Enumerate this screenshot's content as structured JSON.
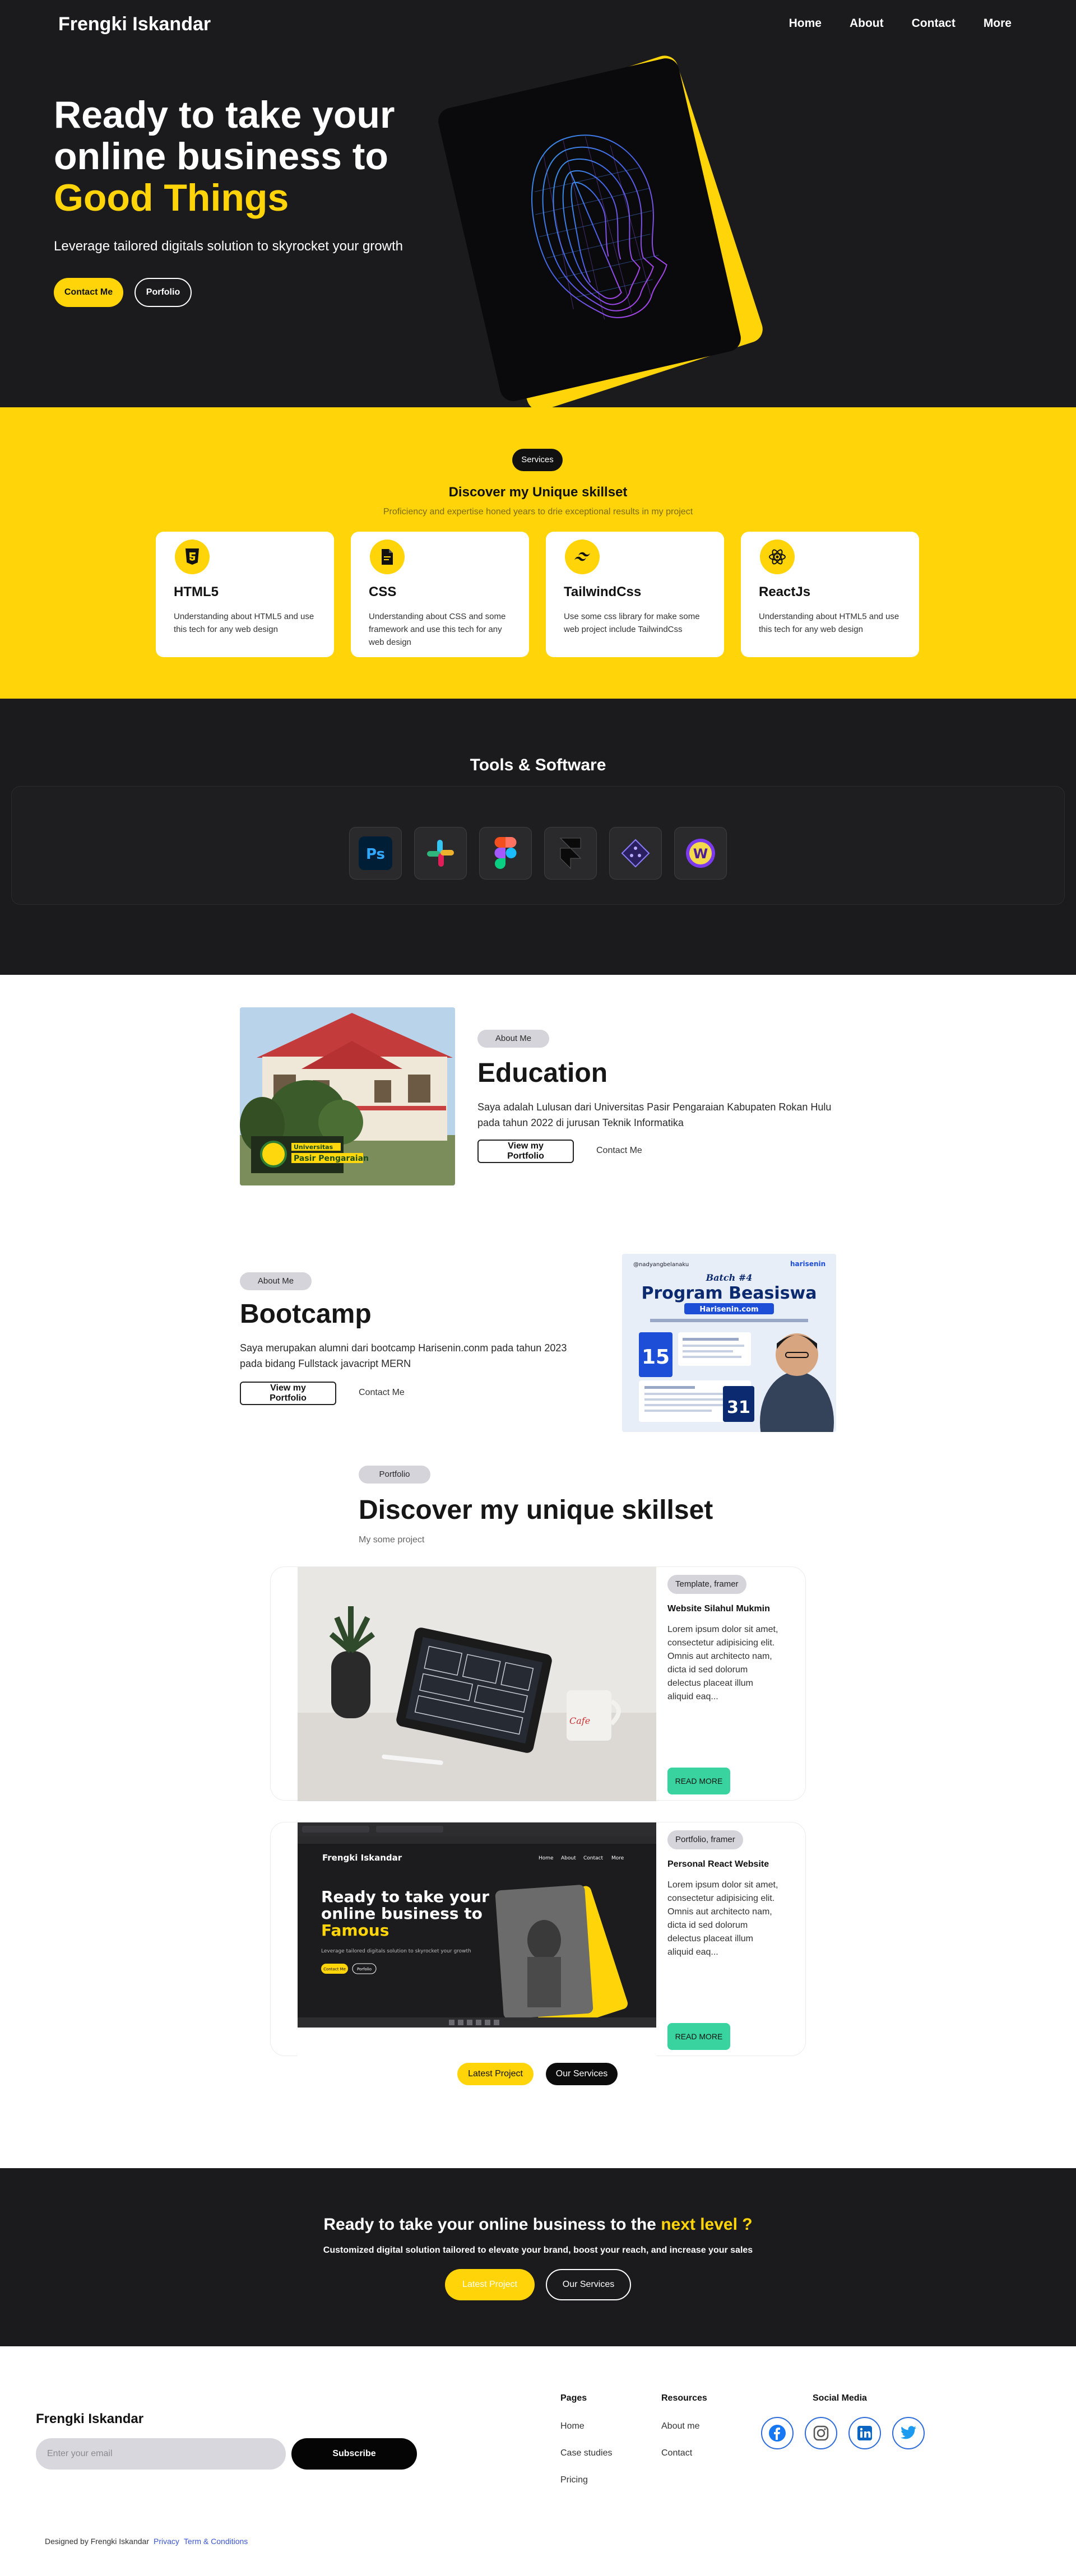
{
  "nav": {
    "brand": "Frengki Iskandar",
    "links": [
      "Home",
      "About",
      "Contact",
      "More"
    ]
  },
  "hero": {
    "title_line1": "Ready to take your",
    "title_line2": "online business to",
    "title_highlight": "Good Things",
    "subtitle": "Leverage tailored digitals solution to skyrocket your growth",
    "cta_primary": "Contact Me",
    "cta_secondary": "Porfolio"
  },
  "services": {
    "badge": "Services",
    "title": "Discover my Unique skillset",
    "subtitle": "Proficiency and expertise honed years to drie exceptional results in my project",
    "items": [
      {
        "name": "HTML5",
        "icon": "html5-icon",
        "desc": "Understanding about HTML5 and use this tech for any web design"
      },
      {
        "name": "CSS",
        "icon": "css-file-icon",
        "desc": "Understanding about CSS and some framework and use this tech for any web design"
      },
      {
        "name": "TailwindCss",
        "icon": "tailwind-icon",
        "desc": "Use some css library for make some web project include TailwindCss"
      },
      {
        "name": "ReactJs",
        "icon": "react-icon",
        "desc": "Understanding about HTML5 and use this tech for any web design"
      }
    ]
  },
  "tools": {
    "title": "Tools & Software",
    "items": [
      "photoshop-icon",
      "slack-icon",
      "figma-icon",
      "framer-icon",
      "linear-icon",
      "webflow-icon"
    ]
  },
  "about": {
    "education": {
      "badge": "About Me",
      "title": "Education",
      "text": "Saya adalah Lulusan dari Universitas Pasir Pengaraian Kabupaten Rokan Hulu pada tahun 2022 di jurusan Teknik Informatika",
      "btn": "View my Portfolio",
      "link": "Contact Me",
      "image_sign_line1": "Universitas",
      "image_sign_line2": "Pasir Pengaraian"
    },
    "bootcamp": {
      "badge": "About Me",
      "title": "Bootcamp",
      "text": "Saya merupakan alumni dari bootcamp Harisenin.conm pada tahun 2023 pada bidang Fullstack javacript MERN",
      "btn": "View my Portfolio",
      "link": "Contact Me",
      "poster": {
        "handle": "@nadyangbelanaku",
        "brand": "harisenin",
        "batch": "Batch #4",
        "title": "Program Beasiswa",
        "site": "Harisenin.com",
        "date1": "15",
        "date2": "31"
      }
    }
  },
  "portfolio": {
    "badge": "Portfolio",
    "title": "Discover my unique skillset",
    "subtitle": "My some project",
    "projects": [
      {
        "tag": "Template, framer",
        "name": "Website Silahul Mukmin",
        "desc": "Lorem ipsum dolor sit amet, consectetur adipisicing elit. Omnis aut architecto nam, dicta id sed dolorum delectus placeat illum aliquid eaq...",
        "btn": "READ MORE"
      },
      {
        "tag": "Portfolio, framer",
        "name": "Personal React Website",
        "desc": "Lorem ipsum dolor sit amet, consectetur adipisicing elit. Omnis aut architecto nam, dicta id sed dolorum delectus placeat illum aliquid eaq...",
        "btn": "READ MORE"
      }
    ],
    "btn_latest": "Latest Project",
    "btn_services": "Our Services",
    "mock": {
      "brand": "Frengki Iskandar",
      "nav": [
        "Home",
        "About",
        "Contact",
        "More"
      ],
      "line1": "Ready to take your",
      "line2": "online business to",
      "highlight": "Famous",
      "sub": "Leverage tailored digitals solution to skyrocket your growth",
      "btn1": "Contact Me",
      "btn2": "Porfolio"
    }
  },
  "cta": {
    "title_main": "Ready to take your online business to the ",
    "title_highlight": "next level ?",
    "subtitle": "Customized digital solution tailored to elevate your brand, boost your reach, and increase your sales",
    "btn_primary": "Latest Project",
    "btn_secondary": "Our Services"
  },
  "footer": {
    "brand": "Frengki Iskandar",
    "email_placeholder": "Enter your email",
    "subscribe": "Subscribe",
    "pages_title": "Pages",
    "pages": [
      "Home",
      "Case studies",
      "Pricing"
    ],
    "resources_title": "Resources",
    "resources": [
      "About me",
      "Contact"
    ],
    "social_title": "Social Media",
    "social": [
      "facebook-icon",
      "instagram-icon",
      "linkedin-icon",
      "twitter-icon"
    ],
    "designed_by": "Designed by Frengki Iskandar",
    "privacy": "Privacy",
    "terms": "Term & Conditions"
  },
  "colors": {
    "accent": "#ffd408",
    "dark": "#1b1b1d",
    "read_more": "#38d39f"
  }
}
